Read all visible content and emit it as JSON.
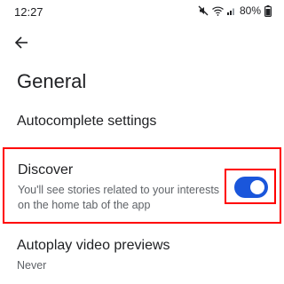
{
  "status_bar": {
    "time": "12:27",
    "battery_percent": "80%",
    "icons": [
      "mute-icon",
      "wifi-icon",
      "signal-icon",
      "battery-icon"
    ]
  },
  "header": {
    "back_icon": "arrow-back-icon",
    "title": "General"
  },
  "settings": {
    "autocomplete": {
      "label": "Autocomplete settings"
    },
    "discover": {
      "label": "Discover",
      "description": "You'll see stories related to your interests on the home tab of the app",
      "enabled": true
    },
    "autoplay": {
      "label": "Autoplay video previews",
      "value": "Never"
    }
  },
  "colors": {
    "toggle_on": "#1a56db",
    "highlight": "#ff0000",
    "secondary_text": "#5f6368"
  }
}
